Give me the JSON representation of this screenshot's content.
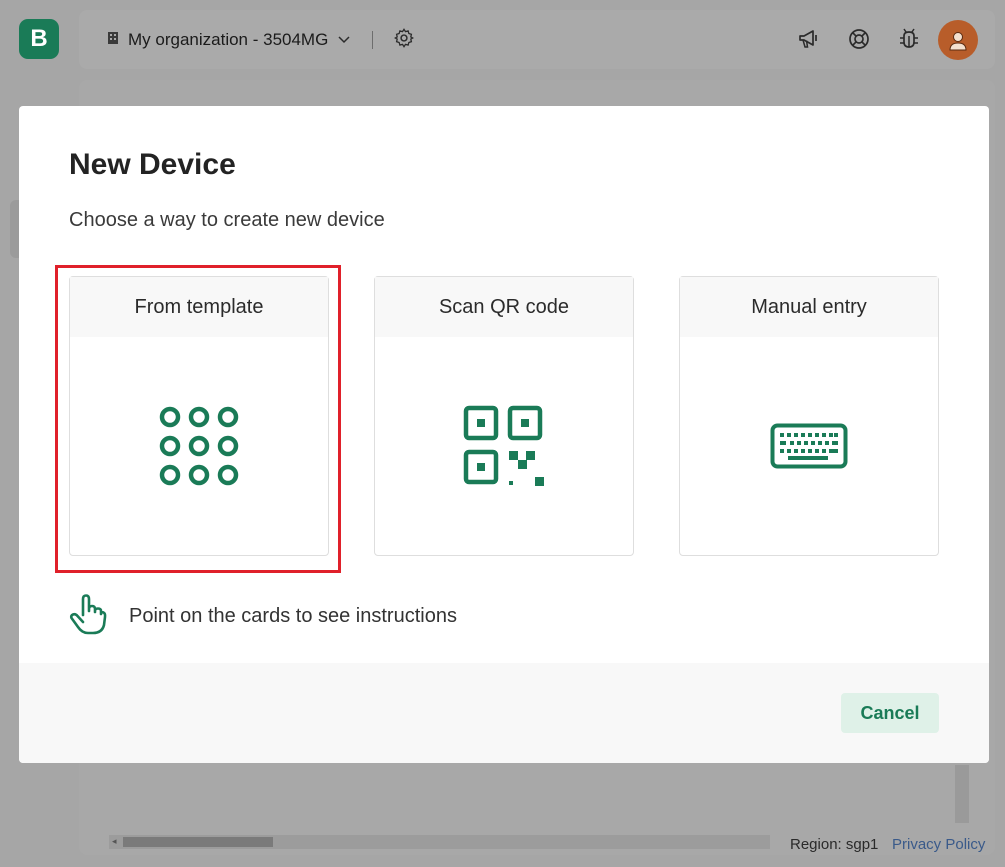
{
  "app": {
    "logo_letter": "B",
    "org_name": "My organization - 3504MG",
    "footer_region": "Region: sgp1",
    "footer_privacy": "Privacy Policy"
  },
  "topbar_icons": [
    "megaphone-icon",
    "lifebuoy-icon",
    "bug-icon",
    "avatar"
  ],
  "modal": {
    "title": "New Device",
    "subtitle": "Choose a way to create new device",
    "cards": [
      {
        "label": "From template",
        "icon": "grid-dots-icon",
        "highlighted": true
      },
      {
        "label": "Scan QR code",
        "icon": "qr-code-icon",
        "highlighted": false
      },
      {
        "label": "Manual entry",
        "icon": "keyboard-icon",
        "highlighted": false
      }
    ],
    "hint": "Point on the cards to see instructions",
    "cancel_label": "Cancel"
  },
  "colors": {
    "brand": "#1a7b57",
    "highlight": "#e0202a",
    "cancel_bg": "#dff1e8",
    "overlay": "#a6a6a6"
  }
}
